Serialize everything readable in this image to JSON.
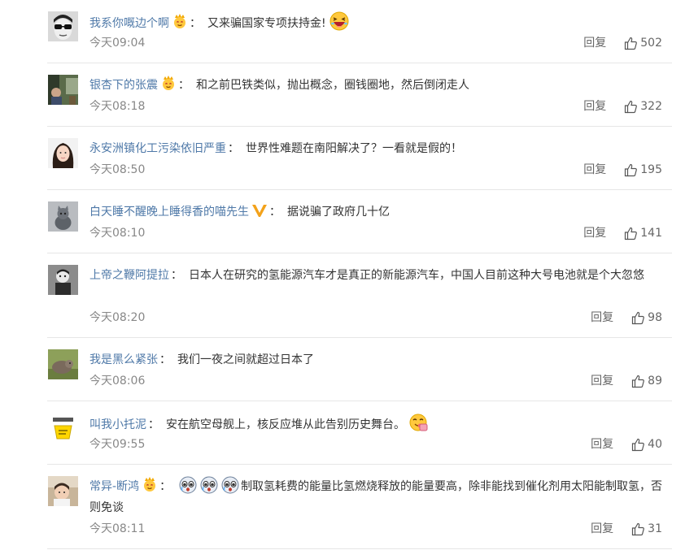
{
  "reply_label": "回复",
  "colors": {
    "username": "#4f79a8",
    "text": "#333333",
    "meta": "#888888",
    "divider": "#e6e6e6"
  },
  "comments": [
    {
      "user": "我系你嘅边个啊",
      "badge": "crown-face-icon",
      "text": "又来骗国家专项扶持金!",
      "emoji_after": [
        "laughing-emoji"
      ],
      "time": "今天09:04",
      "likes": "502",
      "avatar": "avatar-glasses-man"
    },
    {
      "user": "银杏下的张震",
      "badge": "crown-face-icon",
      "text": "和之前巴铁类似，抛出概念，圈钱圈地，然后倒闭走人",
      "time": "今天08:18",
      "likes": "322",
      "avatar": "avatar-outdoor-scene"
    },
    {
      "user": "永安洲镇化工污染依旧严重",
      "text": "世界性难题在南阳解决了？一看就是假的！",
      "time": "今天08:50",
      "likes": "195",
      "avatar": "avatar-woman"
    },
    {
      "user": "白天睡不醒晚上睡得香的喵先生",
      "badge": "v-verified-icon",
      "text": "据说骗了政府几十亿",
      "time": "今天08:10",
      "likes": "141",
      "avatar": "avatar-cat"
    },
    {
      "user": "上帝之鞭阿提拉",
      "text": "日本人在研究的氢能源汽车才是真正的新能源汽车，中国人目前这种大号电池就是个大忽悠",
      "time": "今天08:20",
      "likes": "98",
      "avatar": "avatar-figure"
    },
    {
      "user": "我是黑么紧张",
      "text": "我们一夜之间就超过日本了",
      "time": "今天08:06",
      "likes": "89",
      "avatar": "avatar-animal"
    },
    {
      "user": "叫我小托泥",
      "text": "安在航空母舰上，核反应堆从此告别历史舞台。",
      "emoji_after": [
        "yummy-emoji"
      ],
      "time": "今天09:55",
      "likes": "40",
      "avatar": "avatar-sign"
    },
    {
      "user": "常异-断鸿",
      "badge": "crown-face-icon",
      "emoji_before": [
        "crying-emoji",
        "crying-emoji",
        "crying-emoji"
      ],
      "text": "制取氢耗费的能量比氢燃烧释放的能量要高，除非能找到催化剂用太阳能制取氢，否则免谈",
      "time": "今天08:11",
      "likes": "31",
      "avatar": "avatar-child"
    }
  ]
}
